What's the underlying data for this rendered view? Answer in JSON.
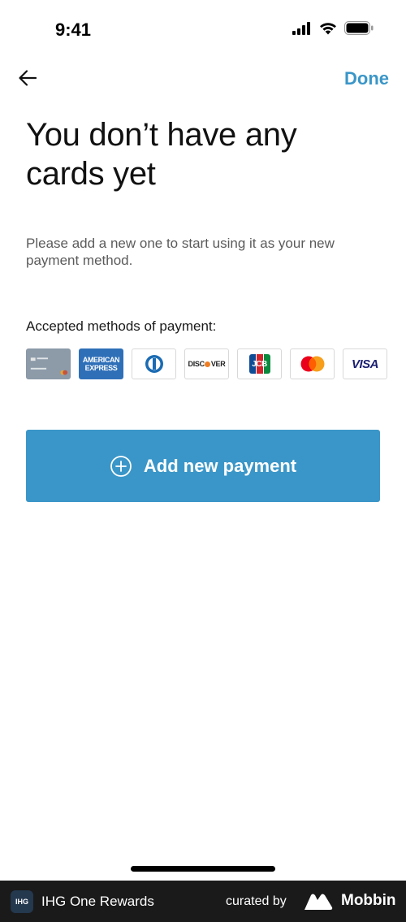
{
  "status_bar": {
    "time": "9:41"
  },
  "nav": {
    "done_label": "Done"
  },
  "content": {
    "title": "You don’t have any cards yet",
    "subtitle": "Please add a new one to start using it as your new payment method.",
    "accepted_label": "Accepted methods of payment:"
  },
  "payment_methods": [
    {
      "name": "IHG card",
      "text": ""
    },
    {
      "name": "American Express",
      "text_line1": "AMERICAN",
      "text_line2": "EXPRESS"
    },
    {
      "name": "Diners Club",
      "text": ""
    },
    {
      "name": "Discover",
      "text": "DISC",
      "text_tail": "VER"
    },
    {
      "name": "JCB",
      "text": "JCB"
    },
    {
      "name": "Mastercard",
      "text": ""
    },
    {
      "name": "Visa",
      "text": "VISA"
    }
  ],
  "add_button": {
    "label": "Add new payment"
  },
  "footer": {
    "app_icon_text": "IHG",
    "app_name": "IHG One Rewards",
    "curated_by": "curated by",
    "brand": "Mobbin"
  },
  "colors": {
    "accent": "#3a96c8",
    "footer_bg": "#1a1a1a"
  }
}
